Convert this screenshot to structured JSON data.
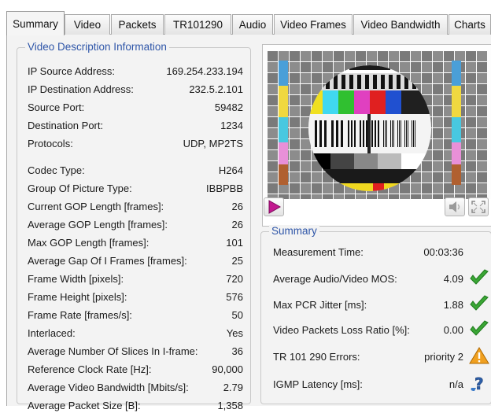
{
  "tabs": [
    {
      "label": "Summary",
      "active": true
    },
    {
      "label": "Video",
      "active": false
    },
    {
      "label": "Packets",
      "active": false
    },
    {
      "label": "TR101290",
      "active": false
    },
    {
      "label": "Audio",
      "active": false
    },
    {
      "label": "Video Frames",
      "active": false
    },
    {
      "label": "Video Bandwidth",
      "active": false
    },
    {
      "label": "Charts",
      "active": false
    }
  ],
  "video_info": {
    "title": "Video Description Information",
    "rows": [
      {
        "label": "IP Source Address:",
        "value": "169.254.233.194"
      },
      {
        "label": "IP Destination Address:",
        "value": "232.5.2.101"
      },
      {
        "label": "Source Port:",
        "value": "59482"
      },
      {
        "label": "Destination Port:",
        "value": "1234"
      },
      {
        "label": "Protocols:",
        "value": "UDP, MP2TS"
      },
      {
        "label": "Codec Type:",
        "value": "H264"
      },
      {
        "label": "Group Of Picture Type:",
        "value": "IBBPBB"
      },
      {
        "label": "Current GOP Length [frames]:",
        "value": "26"
      },
      {
        "label": "Average GOP Length [frames]:",
        "value": "26"
      },
      {
        "label": "Max GOP Length [frames]:",
        "value": "101"
      },
      {
        "label": "Average Gap Of I Frames [frames]:",
        "value": "25"
      },
      {
        "label": "Frame Width [pixels]:",
        "value": "720"
      },
      {
        "label": "Frame Height [pixels]:",
        "value": "576"
      },
      {
        "label": "Frame Rate [frames/s]:",
        "value": "50"
      },
      {
        "label": "Interlaced:",
        "value": "Yes"
      },
      {
        "label": "Average Number Of Slices In I-frame:",
        "value": "36"
      },
      {
        "label": "Reference Clock Rate [Hz]:",
        "value": "90,000"
      },
      {
        "label": "Average Video Bandwidth [Mbits/s]:",
        "value": "2.79"
      },
      {
        "label": "Average Packet Size [B]:",
        "value": "1,358"
      }
    ]
  },
  "summary": {
    "title": "Summary",
    "rows": [
      {
        "label": "Measurement Time:",
        "value": "00:03:36",
        "icon": "none"
      },
      {
        "label": "Average Audio/Video MOS:",
        "value": "4.09",
        "icon": "check-icon"
      },
      {
        "label": "Max PCR Jitter [ms]:",
        "value": "1.88",
        "icon": "check-icon"
      },
      {
        "label": "Video Packets Loss Ratio [%]:",
        "value": "0.00",
        "icon": "check-icon"
      },
      {
        "label": "TR 101 290 Errors:",
        "value": "priority 2",
        "icon": "warning-icon"
      },
      {
        "label": "IGMP Latency [ms]:",
        "value": "n/a",
        "icon": "help-icon"
      }
    ]
  },
  "player": {
    "play_icon": "play-icon",
    "audio_icon": "speaker-icon",
    "fullscreen_icon": "fullscreen-icon"
  },
  "colors": {
    "accent": "#2f56a8",
    "check": "#3aa635",
    "warning": "#f0a020",
    "play": "#c2188f"
  }
}
